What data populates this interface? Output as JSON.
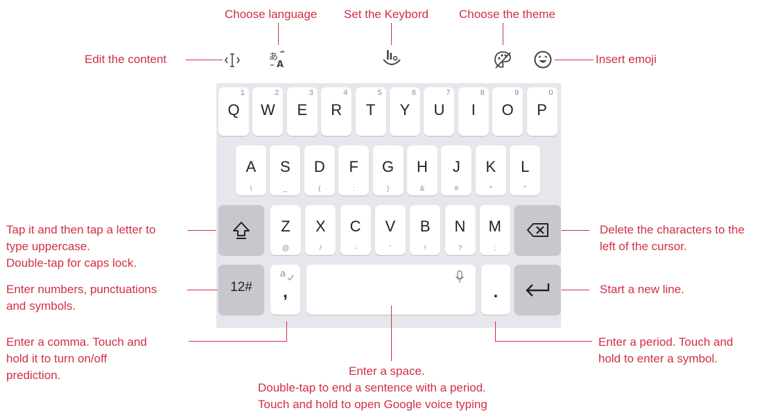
{
  "labels": {
    "choose_language": "Choose language",
    "set_keyboard": "Set the Keybord",
    "choose_theme": "Choose the theme",
    "edit_content": "Edit the content",
    "insert_emoji": "Insert emoji",
    "shift_line1": "Tap it and then tap a letter to",
    "shift_line2": "type uppercase.",
    "shift_line3": "Double-tap for caps lock.",
    "numbers_line1": "Enter numbers, punctuations",
    "numbers_line2": "and symbols.",
    "comma_line1": "Enter a comma. Touch and",
    "comma_line2": "hold it to turn on/off",
    "comma_line3": "prediction.",
    "delete_line1": "Delete the characters to the",
    "delete_line2": "left of the cursor.",
    "newline": "Start a new line.",
    "period_line1": "Enter a period. Touch and",
    "period_line2": "hold to enter a symbol.",
    "space_line1": "Enter a space.",
    "space_line2": "Double-tap to end a sentence with a period.",
    "space_line3": "Touch and hold to open Google voice typing"
  },
  "keyboard": {
    "row1": [
      {
        "k": "Q",
        "h": "1"
      },
      {
        "k": "W",
        "h": "2"
      },
      {
        "k": "E",
        "h": "3"
      },
      {
        "k": "R",
        "h": "4"
      },
      {
        "k": "T",
        "h": "5"
      },
      {
        "k": "Y",
        "h": "6"
      },
      {
        "k": "U",
        "h": "7"
      },
      {
        "k": "I",
        "h": "8"
      },
      {
        "k": "O",
        "h": "9"
      },
      {
        "k": "P",
        "h": "0"
      }
    ],
    "row2": [
      {
        "k": "A",
        "s": "\\"
      },
      {
        "k": "S",
        "s": "_"
      },
      {
        "k": "D",
        "s": "("
      },
      {
        "k": "F",
        "s": ":"
      },
      {
        "k": "G",
        "s": ")"
      },
      {
        "k": "H",
        "s": "&"
      },
      {
        "k": "J",
        "s": "#"
      },
      {
        "k": "K",
        "s": "*"
      },
      {
        "k": "L",
        "s": "\""
      }
    ],
    "row3": [
      {
        "k": "Z",
        "s": "@"
      },
      {
        "k": "X",
        "s": "/"
      },
      {
        "k": "C",
        "s": "-"
      },
      {
        "k": "V",
        "s": "'"
      },
      {
        "k": "B",
        "s": "!"
      },
      {
        "k": "N",
        "s": "?"
      },
      {
        "k": "M",
        "s": ";"
      }
    ],
    "numbers_key": "12#",
    "comma_key": ",",
    "comma_hint": "a",
    "period_key": "."
  },
  "colors": {
    "accent": "#d02f43",
    "keyboard_bg": "#e6e7ec",
    "dark_key": "#c7c8ce"
  },
  "icons": [
    "cursor-edit-icon",
    "translate-icon",
    "keyboard-settings-icon",
    "palette-icon",
    "emoji-icon",
    "shift-icon",
    "backspace-icon",
    "microphone-icon",
    "enter-icon",
    "prediction-check-icon"
  ]
}
